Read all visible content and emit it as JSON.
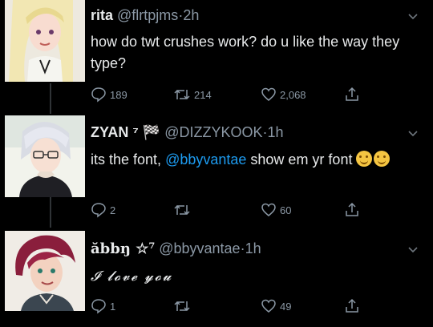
{
  "tweets": [
    {
      "name": "rita",
      "handle": "@flrtpjms",
      "sep": "·",
      "time": "2h",
      "text": "how do twt crushes work? do u like the way they type?",
      "replies": "189",
      "retweets": "214",
      "likes": "2,068"
    },
    {
      "name": "ZYAN",
      "name_suffix": "⁷ 🏁",
      "handle": "@DIZZYKOOK",
      "sep": "·",
      "time": "1h",
      "text_before": "its the font, ",
      "mention": "@bbyvantae",
      "text_after": " show em yr font",
      "replies": "2",
      "retweets": "",
      "likes": "60"
    },
    {
      "name": "ăbbŋ ☆⁷",
      "handle": "@bbyvantae",
      "sep": "·",
      "time": "1h",
      "text": "𝓘 𝓵𝓸𝓿𝓮 𝔂𝓸𝓾",
      "replies": "1",
      "retweets": "",
      "likes": "49"
    }
  ],
  "icons": {
    "reply": "reply-icon",
    "retweet": "retweet-icon",
    "like": "heart-icon",
    "share": "share-icon",
    "more": "chevron-down-icon"
  },
  "colors": {
    "background": "#000000",
    "text": "#e7e9ea",
    "muted": "#8b98a5",
    "link": "#1d9bf0"
  }
}
